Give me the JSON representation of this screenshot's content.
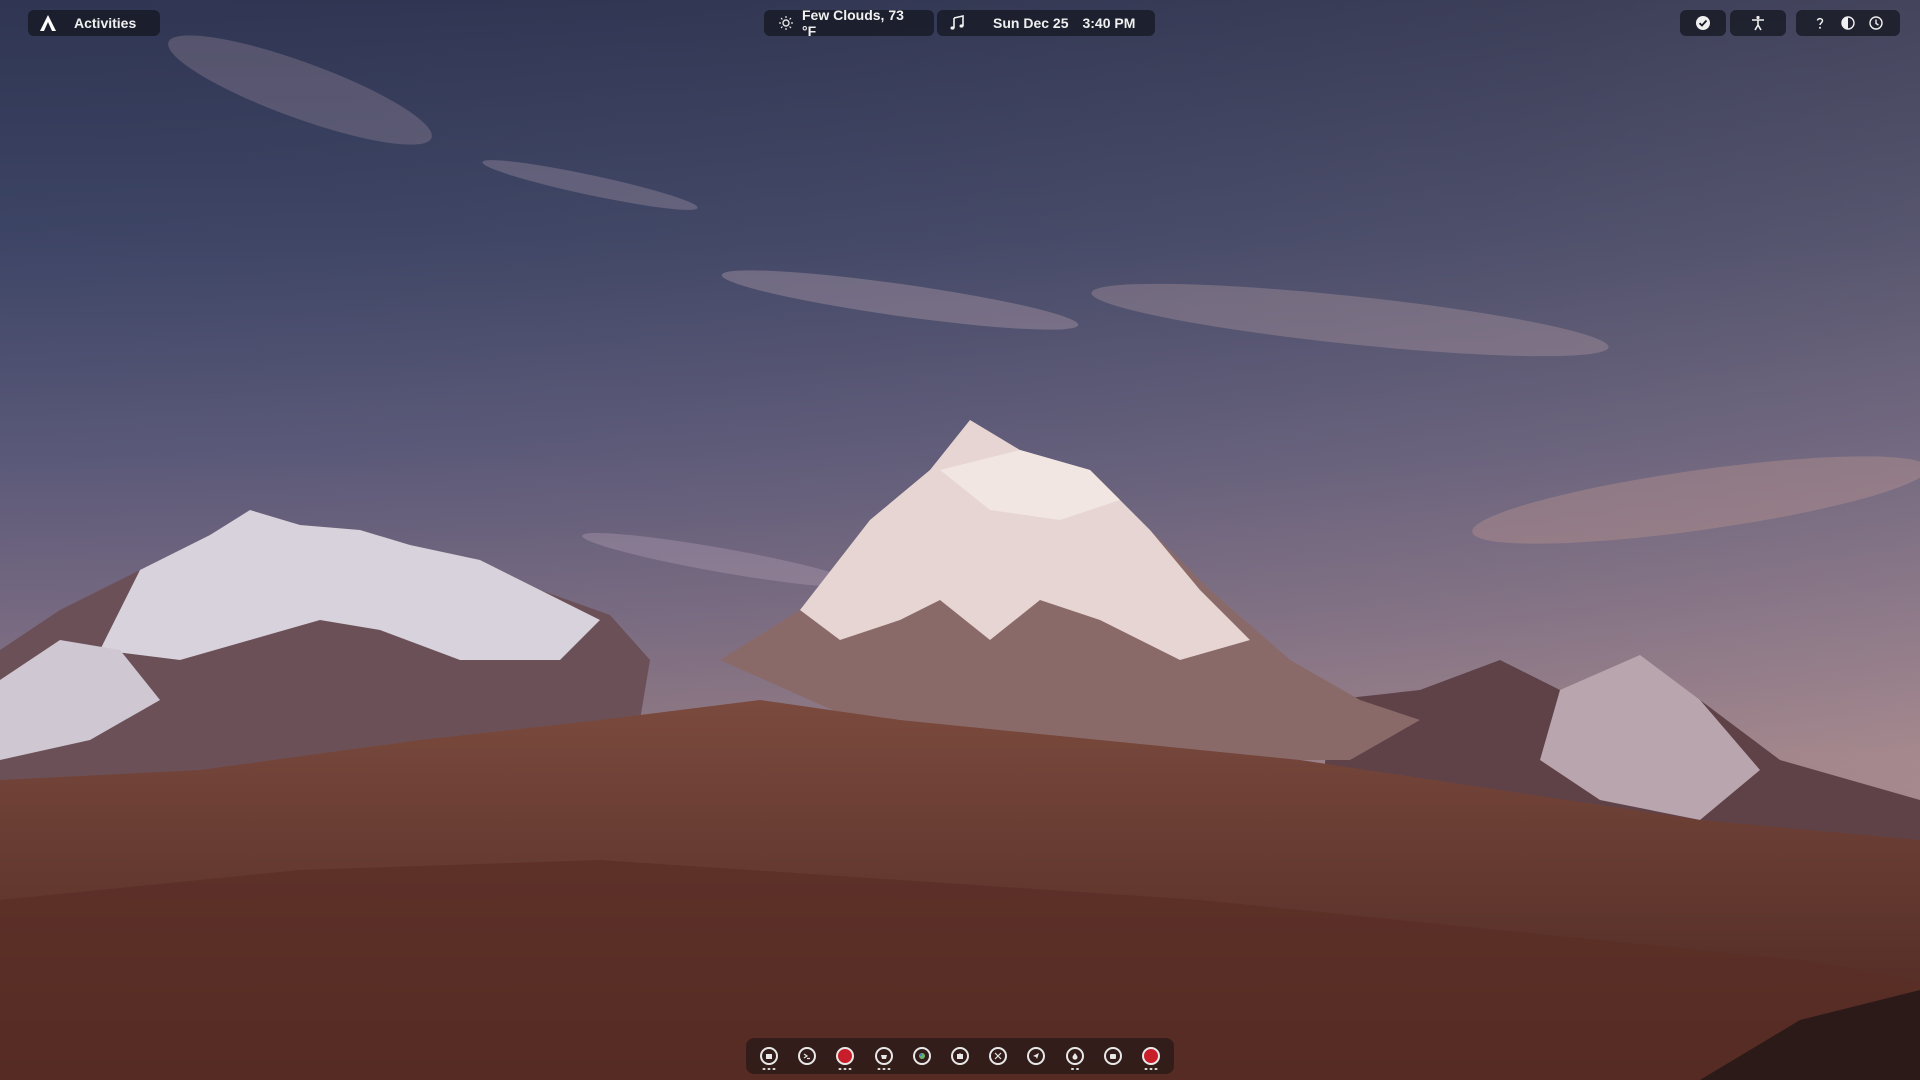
{
  "topbar": {
    "activities_label": "Activities",
    "weather_text": "Few Clouds, 73 °F",
    "date_text": "Sun Dec 25",
    "time_text": "3:40 PM",
    "status_icons": [
      "check-circle-icon",
      "accessibility-icon",
      "help-icon",
      "contrast-icon",
      "power-icon"
    ]
  },
  "dock": {
    "items": [
      {
        "name": "files",
        "icon": "files-icon",
        "running": true,
        "red": false
      },
      {
        "name": "terminal",
        "icon": "terminal-icon",
        "running": false,
        "red": false
      },
      {
        "name": "red-app",
        "icon": "red-circle-icon",
        "running": true,
        "red": true
      },
      {
        "name": "disk-manager",
        "icon": "disk-icon",
        "running": true,
        "red": false
      },
      {
        "name": "browser",
        "icon": "globe-icon",
        "running": false,
        "red": false
      },
      {
        "name": "puzzle",
        "icon": "puzzle-icon",
        "running": false,
        "red": false
      },
      {
        "name": "tools",
        "icon": "tools-icon",
        "running": false,
        "red": false
      },
      {
        "name": "send",
        "icon": "send-icon",
        "running": false,
        "red": false
      },
      {
        "name": "drop",
        "icon": "drop-icon",
        "running": true,
        "red": false
      },
      {
        "name": "screenshot",
        "icon": "camera-icon",
        "running": false,
        "red": false
      },
      {
        "name": "recorder",
        "icon": "record-icon",
        "running": true,
        "red": true
      }
    ]
  },
  "colors": {
    "panel_bg": "#161822",
    "text": "#f0f0f0",
    "accent_red": "#c81e2a"
  }
}
